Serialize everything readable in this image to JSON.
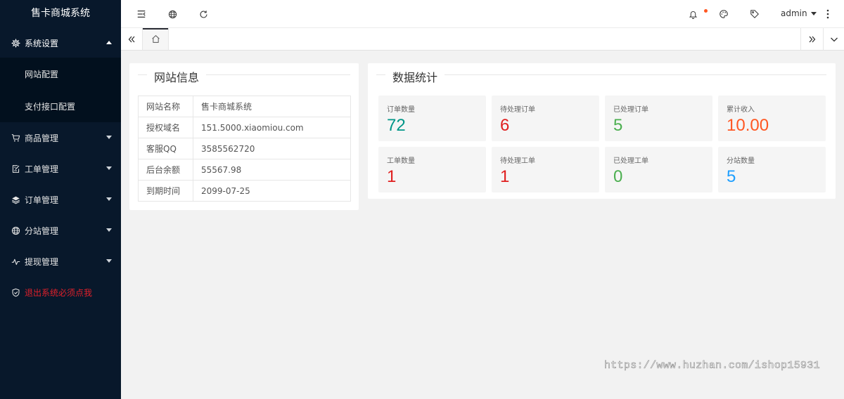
{
  "app": {
    "title": "售卡商城系统"
  },
  "sidebar": {
    "menu_settings": {
      "label": "系统设置",
      "icon": "gear-icon"
    },
    "sub_items": [
      {
        "label": "网站配置"
      },
      {
        "label": "支付接口配置"
      }
    ],
    "items": [
      {
        "label": "商品管理",
        "icon": "cart-icon"
      },
      {
        "label": "工单管理",
        "icon": "edit-icon"
      },
      {
        "label": "订单管理",
        "icon": "layers-icon"
      },
      {
        "label": "分站管理",
        "icon": "globe-icon"
      },
      {
        "label": "提现管理",
        "icon": "pulse-icon"
      }
    ],
    "logout": {
      "label": "退出系统必须点我",
      "icon": "shield-icon",
      "color": "#e0202b"
    }
  },
  "topbar": {
    "icons_left": [
      "menu-toggle-icon",
      "globe-icon",
      "refresh-icon"
    ],
    "icons_right": [
      "bell-icon",
      "palette-icon",
      "tag-icon"
    ],
    "notification_dot_color": "#ff5722",
    "user": "admin",
    "more_icon": "more-vertical-icon"
  },
  "tabs": {
    "home_icon": "home-icon"
  },
  "site_info": {
    "title": "网站信息",
    "rows": [
      {
        "key": "网站名称",
        "value": "售卡商城系统"
      },
      {
        "key": "授权域名",
        "value": "151.5000.xiaomiou.com"
      },
      {
        "key": "客服QQ",
        "value": "3585562720"
      },
      {
        "key": "后台余额",
        "value": "55567.98"
      },
      {
        "key": "到期时间",
        "value": "2099-07-25"
      }
    ]
  },
  "stats": {
    "title": "数据统计",
    "items": [
      {
        "label": "订单数量",
        "value": "72",
        "color": "#009688"
      },
      {
        "label": "待处理订单",
        "value": "6",
        "color": "#e01f1f"
      },
      {
        "label": "已处理订单",
        "value": "5",
        "color": "#4caf50"
      },
      {
        "label": "累计收入",
        "value": "10.00",
        "color": "#ff5722"
      },
      {
        "label": "工单数量",
        "value": "1",
        "color": "#e01f1f"
      },
      {
        "label": "待处理工单",
        "value": "1",
        "color": "#e01f1f"
      },
      {
        "label": "已处理工单",
        "value": "0",
        "color": "#4caf50"
      },
      {
        "label": "分站数量",
        "value": "5",
        "color": "#1e9fff"
      }
    ]
  },
  "watermark": "https://www.huzhan.com/ishop15931"
}
